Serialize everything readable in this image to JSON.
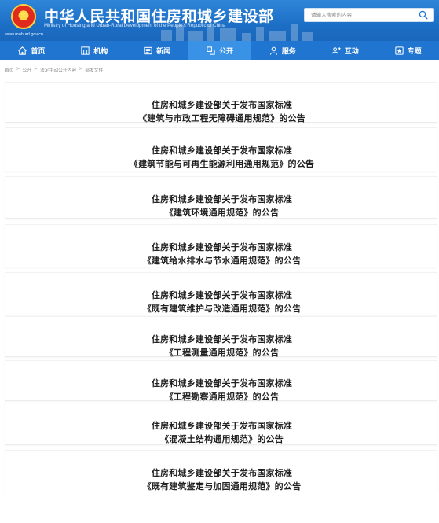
{
  "header": {
    "site_title": "中华人民共和国住房和城乡建设部",
    "site_subtitle": "Ministry of Housing and Urban-Rural Development of the People's Republic of China",
    "site_url": "www.mohurd.gov.cn",
    "emblem_icon": "national-emblem-icon"
  },
  "search": {
    "placeholder": "请输入搜索的内容",
    "icon": "search-icon"
  },
  "nav": {
    "items": [
      {
        "label": "首页",
        "icon": "home-icon"
      },
      {
        "label": "机构",
        "icon": "building-icon"
      },
      {
        "label": "新闻",
        "icon": "newspaper-icon"
      },
      {
        "label": "公开",
        "icon": "public-info-icon",
        "active": true
      },
      {
        "label": "服务",
        "icon": "person-service-icon"
      },
      {
        "label": "互动",
        "icon": "interaction-icon"
      },
      {
        "label": "专题",
        "icon": "special-topic-icon"
      }
    ]
  },
  "breadcrumb": {
    "items": [
      "首页",
      "公开",
      "法定主动公开内容",
      "部发文件"
    ],
    "separator": ">"
  },
  "articles": [
    {
      "line1": "住房和城乡建设部关于发布国家标准",
      "line2": "《建筑与市政工程无障碍通用规范》的公告"
    },
    {
      "line1": "住房和城乡建设部关于发布国家标准",
      "line2": "《建筑节能与可再生能源利用通用规范》的公告"
    },
    {
      "line1": "住房和城乡建设部关于发布国家标准",
      "line2": "《建筑环境通用规范》的公告"
    },
    {
      "line1": "住房和城乡建设部关于发布国家标准",
      "line2": "《建筑给水排水与节水通用规范》的公告"
    },
    {
      "line1": "住房和城乡建设部关于发布国家标准",
      "line2": "《既有建筑维护与改造通用规范》的公告"
    },
    {
      "line1": "住房和城乡建设部关于发布国家标准",
      "line2": "《工程测量通用规范》的公告"
    },
    {
      "line1": "住房和城乡建设部关于发布国家标准",
      "line2": "《工程勘察通用规范》的公告"
    },
    {
      "line1": "住房和城乡建设部关于发布国家标准",
      "line2": "《混凝土结构通用规范》的公告"
    },
    {
      "line1": "住房和城乡建设部关于发布国家标准",
      "line2": "《既有建筑鉴定与加固通用规范》的公告"
    }
  ],
  "colors": {
    "header_blue": "#1c6fc6",
    "nav_blue": "#1f75d0",
    "nav_active": "#3a92e6"
  }
}
